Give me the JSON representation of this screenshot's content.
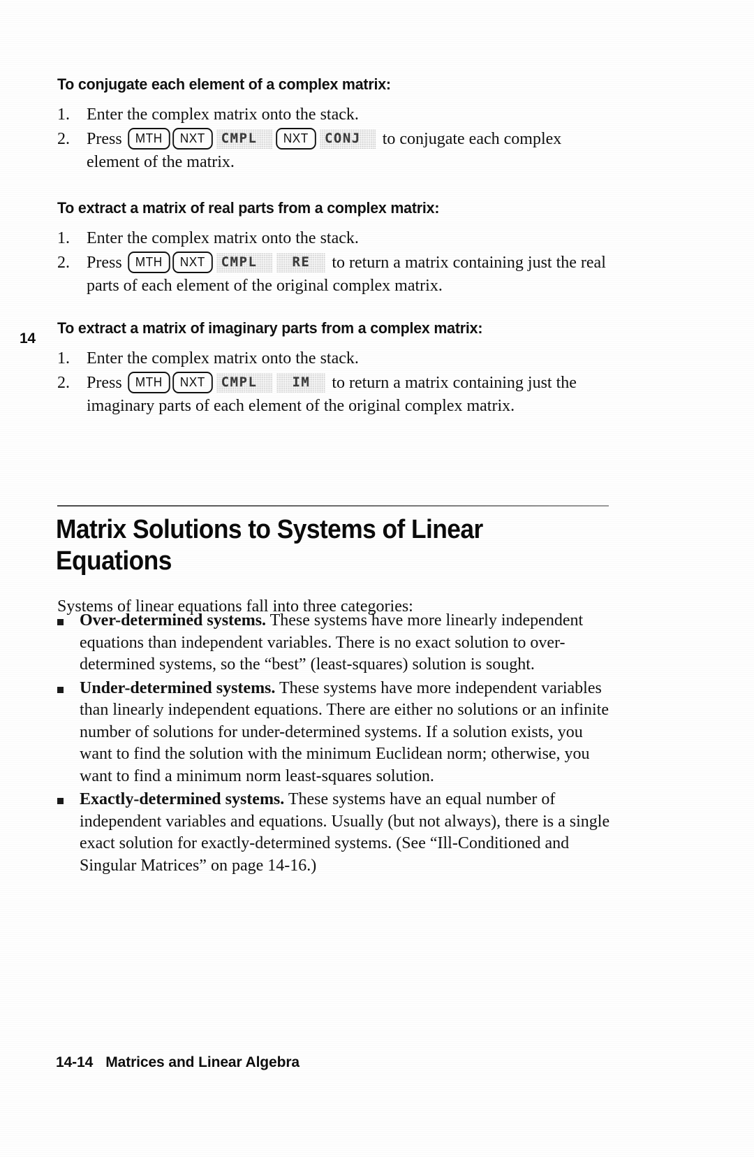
{
  "page": {
    "chapter_tab": "14",
    "footer_page_number": "14-14",
    "footer_title": "Matrices and Linear Algebra"
  },
  "procedures": [
    {
      "heading": "To conjugate each element of a complex matrix:",
      "steps": [
        {
          "number": "1.",
          "parts": [
            {
              "type": "text",
              "value": "Enter the complex matrix onto the stack."
            }
          ]
        },
        {
          "number": "2.",
          "parts": [
            {
              "type": "text",
              "value": "Press "
            },
            {
              "type": "key",
              "value": "MTH"
            },
            {
              "type": "key",
              "value": "NXT"
            },
            {
              "type": "softkey",
              "value": "CMPL"
            },
            {
              "type": "key",
              "value": "NXT"
            },
            {
              "type": "softkey",
              "value": "CONJ"
            },
            {
              "type": "text",
              "value": " to conjugate each complex element of the matrix."
            }
          ]
        }
      ]
    },
    {
      "heading": "To extract a matrix of real parts from a complex matrix:",
      "steps": [
        {
          "number": "1.",
          "parts": [
            {
              "type": "text",
              "value": "Enter the complex matrix onto the stack."
            }
          ]
        },
        {
          "number": "2.",
          "parts": [
            {
              "type": "text",
              "value": "Press "
            },
            {
              "type": "key",
              "value": "MTH"
            },
            {
              "type": "key",
              "value": "NXT"
            },
            {
              "type": "softkey",
              "value": "CMPL"
            },
            {
              "type": "softkey",
              "value": "RE"
            },
            {
              "type": "text",
              "value": " to return a matrix containing just the real parts of each element of the original complex matrix."
            }
          ]
        }
      ]
    },
    {
      "heading": "To extract a matrix of imaginary parts from a complex matrix:",
      "steps": [
        {
          "number": "1.",
          "parts": [
            {
              "type": "text",
              "value": "Enter the complex matrix onto the stack."
            }
          ]
        },
        {
          "number": "2.",
          "parts": [
            {
              "type": "text",
              "value": "Press "
            },
            {
              "type": "key",
              "value": "MTH"
            },
            {
              "type": "key",
              "value": "NXT"
            },
            {
              "type": "softkey",
              "value": "CMPL"
            },
            {
              "type": "softkey",
              "value": "IM"
            },
            {
              "type": "text",
              "value": " to return a matrix containing just the imaginary parts of each element of the original complex matrix."
            }
          ]
        }
      ]
    }
  ],
  "section": {
    "title": "Matrix Solutions to Systems of Linear Equations",
    "intro": "Systems of linear equations fall into three categories:",
    "bullets": [
      {
        "lead": "Over-determined systems.",
        "body": " These systems have more linearly independent equations than independent variables. There is no exact solution to over-determined systems, so the “best” (least-squares) solution is sought."
      },
      {
        "lead": "Under-determined systems.",
        "body": " These systems have more independent variables than linearly independent equations. There are either no solutions or an infinite number of solutions for under-determined systems. If a solution exists, you want to find the solution with the minimum Euclidean norm; otherwise, you want to find a minimum norm least-squares solution."
      },
      {
        "lead": "Exactly-determined systems.",
        "body": " These systems have an equal number of independent variables and equations. Usually (but not always), there is a single exact solution for exactly-determined systems. (See “Ill-Conditioned and Singular Matrices” on page 14-16.)"
      }
    ]
  }
}
